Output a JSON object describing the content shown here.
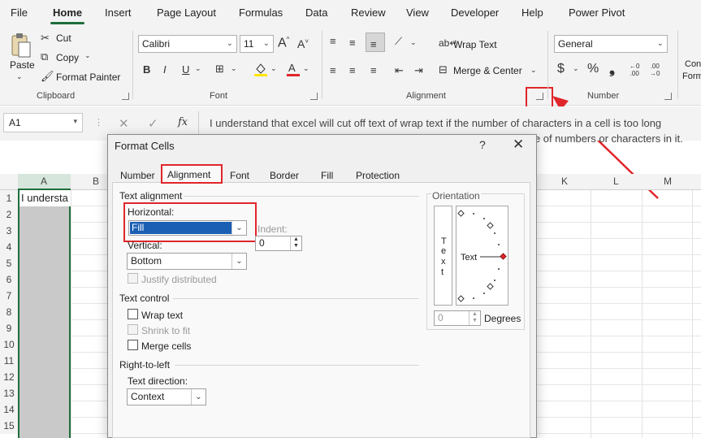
{
  "menu": {
    "items": [
      "File",
      "Home",
      "Insert",
      "Page Layout",
      "Formulas",
      "Data",
      "Review",
      "View",
      "Developer",
      "Help",
      "Power Pivot"
    ]
  },
  "ribbon": {
    "clipboard": {
      "label": "Clipboard",
      "paste": "Paste",
      "cut": "Cut",
      "copy": "Copy",
      "format_painter": "Format Painter"
    },
    "font": {
      "label": "Font",
      "font_name": "Calibri",
      "font_size": "11",
      "bold": "B",
      "italic": "I",
      "underline": "U",
      "increase": "A^",
      "decrease": "A˅"
    },
    "alignment": {
      "label": "Alignment",
      "wrap_text": "Wrap Text",
      "merge_center": "Merge & Center"
    },
    "number": {
      "label": "Number",
      "format": "General",
      "currency": "$",
      "percent": "%",
      "comma": "❟"
    },
    "partial": {
      "line1": "Con",
      "line2": "Form"
    }
  },
  "formula_bar": {
    "name_box": "A1",
    "fx": "fx",
    "text_line1": "I understand that excel will cut off text of wrap text if the number of characters in a cell is too long",
    "text_line2": "le of numbers or characters in it."
  },
  "grid": {
    "columns": [
      "A",
      "B",
      "K",
      "L",
      "M"
    ],
    "rows": [
      "1",
      "2",
      "3",
      "4",
      "5",
      "6",
      "7",
      "8",
      "9",
      "10",
      "11",
      "12",
      "13",
      "14",
      "15"
    ],
    "a1_value": "I understa"
  },
  "dialog": {
    "title": "Format Cells",
    "help": "?",
    "close": "✕",
    "tabs": [
      "Number",
      "Alignment",
      "Font",
      "Border",
      "Fill",
      "Protection"
    ],
    "text_alignment": {
      "label": "Text alignment",
      "horizontal_label": "Horizontal:",
      "horizontal_value": "Fill",
      "indent_label": "Indent:",
      "indent_value": "0",
      "vertical_label": "Vertical:",
      "vertical_value": "Bottom",
      "justify_distributed": "Justify distributed"
    },
    "text_control": {
      "label": "Text control",
      "wrap_text": "Wrap text",
      "shrink_to_fit": "Shrink to fit",
      "merge_cells": "Merge cells"
    },
    "rtl": {
      "label": "Right-to-left",
      "direction_label": "Text direction:",
      "direction_value": "Context"
    },
    "orientation": {
      "label": "Orientation",
      "vertical_text": [
        "T",
        "e",
        "x",
        "t"
      ],
      "dial_text": "Text",
      "degrees_value": "0",
      "degrees_label": "Degrees"
    }
  },
  "colors": {
    "accent_green": "#1e6e3a",
    "highlight_red": "#e0262b",
    "selection_blue": "#1a5fb4"
  }
}
